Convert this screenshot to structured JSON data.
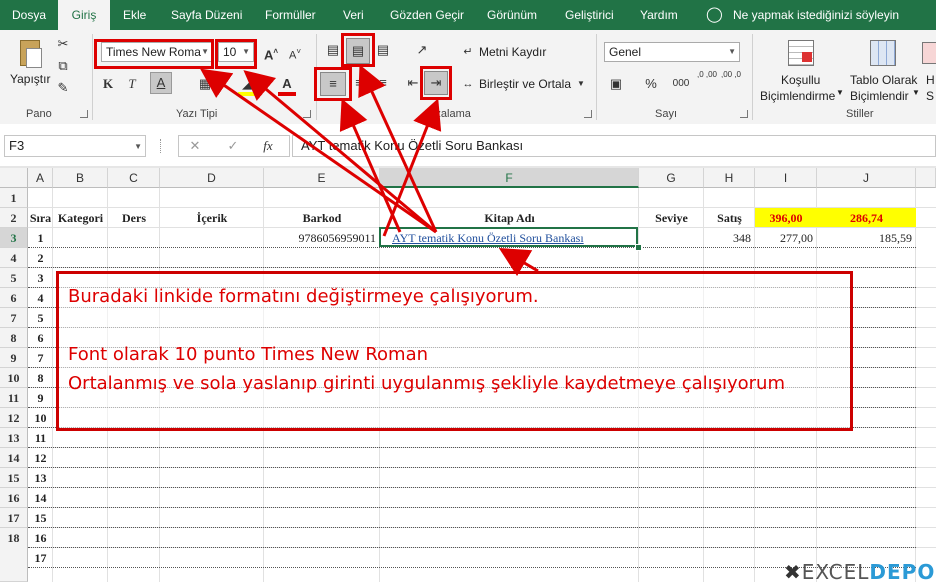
{
  "menu": {
    "tabs": [
      "Dosya",
      "Giriş",
      "Ekle",
      "Sayfa Düzeni",
      "Formüller",
      "Veri",
      "Gözden Geçir",
      "Görünüm",
      "Geliştirici",
      "Yardım"
    ],
    "active": "Giriş",
    "tell_me": "Ne yapmak istediğinizi söyleyin"
  },
  "ribbon": {
    "paste_label": "Yapıştır",
    "group_clipboard": "Pano",
    "font_name": "Times New Roma",
    "font_size": "10",
    "group_font": "Yazı Tipi",
    "wrap_text": "Metni Kaydır",
    "merge_center": "Birleştir ve Ortala",
    "group_alignment": "Hizalama",
    "number_format": "Genel",
    "group_number": "Sayı",
    "conditional_format_1": "Koşullu",
    "conditional_format_2": "Biçimlendirme",
    "format_table_1": "Tablo Olarak",
    "format_table_2": "Biçimlendir",
    "cell_styles_1": "H",
    "cell_styles_2": "S",
    "group_styles": "Stiller",
    "percent": "%",
    "thousands": "000",
    "dec_inc": ",0 ,00",
    "dec_dec": ",00 ,0"
  },
  "formula_bar": {
    "name_box": "F3",
    "fx": "fx",
    "content": "AYT tematik Konu Özetli Soru Bankası"
  },
  "sheet": {
    "columns": [
      "A",
      "B",
      "C",
      "D",
      "E",
      "F",
      "G",
      "H",
      "I",
      "J"
    ],
    "rows": [
      "1",
      "2",
      "3",
      "4",
      "5",
      "6",
      "7",
      "8",
      "9",
      "10",
      "11",
      "12",
      "13",
      "14",
      "15",
      "16",
      "17",
      "18"
    ],
    "headers": {
      "A": "Sıra",
      "B": "Kategori",
      "C": "Ders",
      "D": "İçerik",
      "E": "Barkod",
      "F": "Kitap Adı",
      "G": "Seviye",
      "H": "Satış",
      "I": "396,00",
      "J": "286,74"
    },
    "row3": {
      "A": "1",
      "E": "9786056959011",
      "F": "AYT tematik Konu Özetli Soru Bankası",
      "H": "348",
      "I": "277,00",
      "J": "185,59"
    },
    "sira_numbers": [
      "2",
      "3",
      "4",
      "5",
      "6",
      "7",
      "8",
      "9",
      "10",
      "11",
      "12",
      "13",
      "14",
      "15",
      "16",
      "17"
    ]
  },
  "annotation": {
    "line1": "Buradaki linkide formatını değiştirmeye çalışıyorum.",
    "line2": "Font olarak 10 punto Times New Roman",
    "line3": "Ortalanmış ve sola yaslanıp girinti uygulanmış şekliyle kaydetmeye çalışıyorum"
  },
  "watermark": {
    "text1": "EXCEL",
    "text2": "DEPO"
  },
  "colors": {
    "excel_green": "#217346",
    "highlight_yellow": "#ffff00",
    "annotation_red": "#dd0000",
    "link_blue": "#1f4e9c"
  }
}
